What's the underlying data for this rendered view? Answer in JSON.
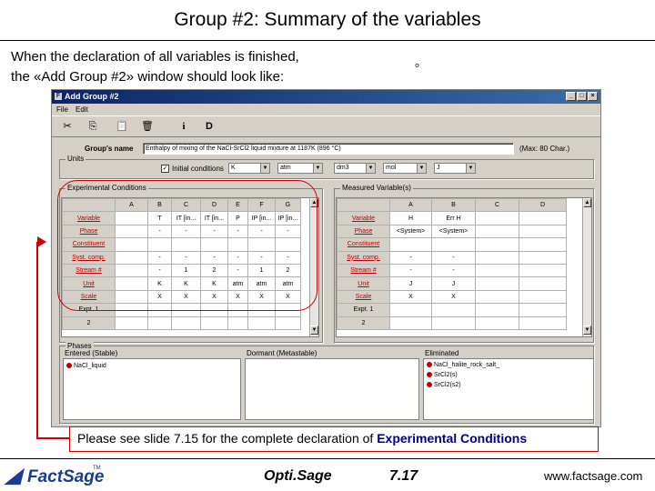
{
  "slide": {
    "title": "Group #2: Summary of the variables",
    "intro_line1": "When the declaration of all variables is finished,",
    "intro_line2": "the «Add Group #2» window should look like:",
    "dot": "。"
  },
  "window": {
    "title": "Add Group #2",
    "menu": [
      "File",
      "Edit"
    ],
    "group_name_label": "Group's name",
    "group_name_value": "Enthalpy of mixing of the NaCl-SrCl2 liquid mixture at 1187K (896 °C)",
    "max_chars": "(Max: 80 Char.)",
    "units_label": "Units",
    "initial_conditions_label": "Initial conditions",
    "unit_values": [
      "K",
      "atm",
      "dm3",
      "mol",
      "J"
    ]
  },
  "experimental": {
    "title": "Experimental Conditions",
    "columns": [
      "A",
      "B",
      "C",
      "D",
      "E",
      "F",
      "G"
    ],
    "rows": [
      {
        "head": "Variable",
        "link": true,
        "cells": [
          "",
          "T",
          "IT [in...",
          "IT [in...",
          "P",
          "IP [in...",
          "IP [in..."
        ]
      },
      {
        "head": "Phase",
        "link": true,
        "cells": [
          "",
          "-",
          "-",
          "-",
          "-",
          "-",
          "-"
        ]
      },
      {
        "head": "Constituent",
        "link": true,
        "cells": [
          "",
          "",
          "",
          "",
          "",
          "",
          ""
        ]
      },
      {
        "head": "Syst. comp.",
        "link": true,
        "cells": [
          "",
          "-",
          "-",
          "-",
          "-",
          "-",
          "-"
        ]
      },
      {
        "head": "Stream #",
        "link": true,
        "cells": [
          "",
          "-",
          "1",
          "2",
          "-",
          "1",
          "2"
        ]
      },
      {
        "head": "Unit",
        "link": true,
        "cells": [
          "",
          "K",
          "K",
          "K",
          "atm",
          "atm",
          "atm"
        ]
      },
      {
        "head": "Scale",
        "link": true,
        "cells": [
          "",
          "X",
          "X",
          "X",
          "X",
          "X",
          "X"
        ]
      },
      {
        "head": "Expt. 1",
        "link": false,
        "cells": [
          "",
          "",
          "",
          "",
          "",
          "",
          ""
        ]
      },
      {
        "head": "2",
        "link": false,
        "cells": [
          "",
          "",
          "",
          "",
          "",
          "",
          ""
        ]
      }
    ]
  },
  "measured": {
    "title": "Measured Variable(s)",
    "columns": [
      "A",
      "B",
      "C",
      "D"
    ],
    "rows": [
      {
        "head": "Variable",
        "link": true,
        "cells": [
          "H",
          "Err H",
          "",
          ""
        ]
      },
      {
        "head": "Phase",
        "link": true,
        "cells": [
          "<System>",
          "<System>",
          "",
          ""
        ]
      },
      {
        "head": "Constituent",
        "link": true,
        "cells": [
          "",
          "",
          "",
          ""
        ]
      },
      {
        "head": "Syst. comp.",
        "link": true,
        "cells": [
          "-",
          "-",
          "",
          ""
        ]
      },
      {
        "head": "Stream #",
        "link": true,
        "cells": [
          "-",
          "-",
          "",
          ""
        ]
      },
      {
        "head": "Unit",
        "link": true,
        "cells": [
          "J",
          "J",
          "",
          ""
        ]
      },
      {
        "head": "Scale",
        "link": true,
        "cells": [
          "X",
          "X",
          "",
          ""
        ]
      },
      {
        "head": "Expt. 1",
        "link": false,
        "cells": [
          "",
          "",
          "",
          ""
        ]
      },
      {
        "head": "2",
        "link": false,
        "cells": [
          "",
          "",
          "",
          ""
        ]
      }
    ]
  },
  "phases": {
    "title": "Phases",
    "entered_title": "Entered (Stable)",
    "entered_items": [
      "NaCl_liquid"
    ],
    "dormant_title": "Dormant (Metastable)",
    "eliminated_title": "Eliminated",
    "eliminated_items": [
      "NaCl_halite_rock_salt_",
      "SrCl2(s)",
      "SrCl2(s2)"
    ]
  },
  "note": {
    "prefix": "Please see slide 7.15 for the complete declaration of ",
    "highlight": "Experimental Conditions"
  },
  "footer": {
    "logo_text": "FactSage",
    "logo_tm": "TM",
    "center": "Opti.Sage",
    "slide_number": "7.17",
    "url": "www.factsage.com"
  },
  "colors": {
    "annotation_red": "#d00000",
    "link_red": "#c00000",
    "titlebar_blue": "#0a246a",
    "logo_blue": "#1a3d8f"
  }
}
